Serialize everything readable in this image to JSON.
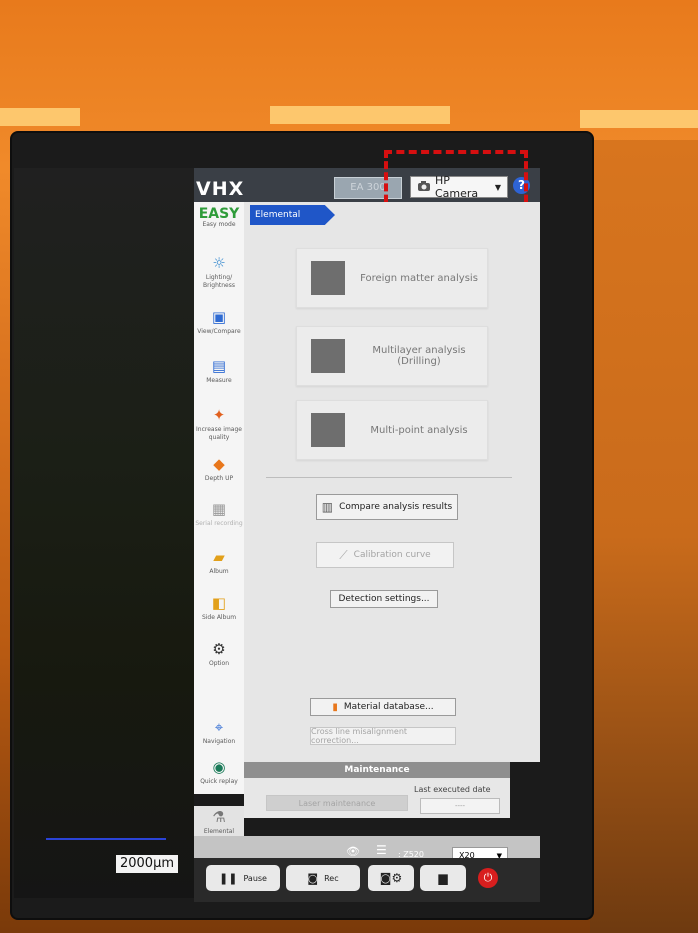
{
  "header": {
    "logo": "VHX",
    "ea_button": "EA 300",
    "camera": {
      "selected": "HP Camera"
    },
    "help_symbol": "?"
  },
  "sidebar": {
    "items": [
      {
        "label": "EASY",
        "sub": "Easy mode",
        "icon": "easy-icon"
      },
      {
        "label": "Lighting/ Brightness",
        "icon": "light-bulb-icon"
      },
      {
        "label": "View/Compare",
        "icon": "view-compare-icon"
      },
      {
        "label": "Measure",
        "icon": "ruler-icon"
      },
      {
        "label": "Increase image quality",
        "icon": "magic-wand-icon"
      },
      {
        "label": "Depth UP",
        "icon": "depth-diamond-icon"
      },
      {
        "label": "Serial recording",
        "icon": "grid-icon"
      },
      {
        "label": "Album",
        "icon": "folder-icon"
      },
      {
        "label": "Side Album",
        "icon": "side-album-icon"
      },
      {
        "label": "Option",
        "icon": "gear-icon"
      },
      {
        "label": "Navigation",
        "icon": "navigation-icon"
      },
      {
        "label": "Quick replay",
        "icon": "replay-icon"
      },
      {
        "label": "Elemental analysis",
        "icon": "elemental-analysis-icon"
      }
    ]
  },
  "main": {
    "breadcrumb": "Elemental analysis",
    "tiles": [
      {
        "label": "Foreign matter analysis"
      },
      {
        "label": "Multilayer analysis\n(Drilling)"
      },
      {
        "label": "Multi-point analysis"
      }
    ],
    "buttons": {
      "compare": "Compare analysis results",
      "calibration": "Calibration curve",
      "detection": "Detection settings...",
      "material_db": "Material database...",
      "cross_line": "Cross line misalignment correction..."
    },
    "maintenance": {
      "title": "Maintenance",
      "last_label": "Last executed date",
      "last_value": "----",
      "laser_button": "Laser maintenance"
    }
  },
  "bottom": {
    "z_readout": ": Z520",
    "zoom": "X20",
    "pause_label": "Pause",
    "rec_label": "Rec"
  },
  "overlay": {
    "scale_bar_label": "2000µm"
  },
  "colors": {
    "accent_blue": "#1f56c8",
    "highlight_red": "#d60f10",
    "easy_green": "#2f9c3a"
  }
}
